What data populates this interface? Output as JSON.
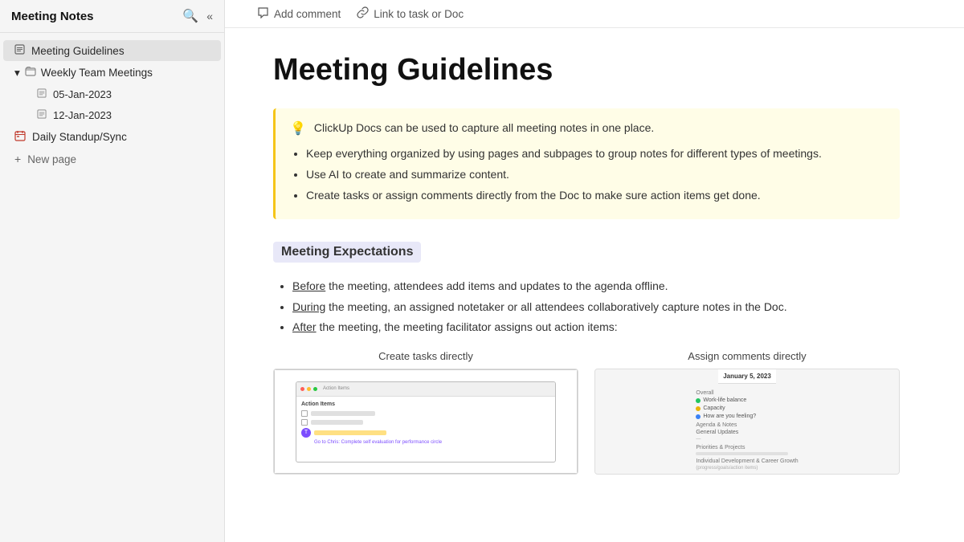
{
  "sidebar": {
    "title": "Meeting Notes",
    "items": [
      {
        "id": "meeting-guidelines",
        "label": "Meeting Guidelines",
        "type": "doc",
        "active": true
      },
      {
        "id": "weekly-team-meetings",
        "label": "Weekly Team Meetings",
        "type": "folder",
        "expanded": true,
        "children": [
          {
            "id": "jan-05",
            "label": "05-Jan-2023",
            "type": "doc"
          },
          {
            "id": "jan-12",
            "label": "12-Jan-2023",
            "type": "doc"
          }
        ]
      },
      {
        "id": "daily-standup",
        "label": "Daily Standup/Sync",
        "type": "calendar"
      },
      {
        "id": "new-page",
        "label": "New page",
        "type": "new"
      }
    ]
  },
  "toolbar": {
    "add_comment_label": "Add comment",
    "link_task_label": "Link to task or Doc"
  },
  "content": {
    "page_title": "Meeting Guidelines",
    "callout": {
      "emoji": "💡",
      "text": "ClickUp Docs can be used to capture all meeting notes in one place.",
      "bullets": [
        "Keep everything organized by using pages and subpages to group notes for different types of meetings.",
        "Use AI to create and summarize content.",
        "Create tasks or assign comments directly from the Doc to make sure action items get done."
      ]
    },
    "section_heading": "Meeting Expectations",
    "bullets": [
      {
        "prefix_underline": "Before",
        "rest": " the meeting, attendees add items and updates to the agenda offline."
      },
      {
        "prefix_underline": "During",
        "rest": " the meeting, an assigned notetaker or all attendees collaboratively capture notes in the Doc."
      },
      {
        "prefix_underline": "After",
        "rest": " the meeting, the meeting facilitator assigns out action items:"
      }
    ],
    "images": {
      "left_caption": "Create tasks directly",
      "right_caption": "Assign comments directly",
      "right_date": "January 5, 2023"
    }
  },
  "icons": {
    "search": "🔍",
    "collapse": "«",
    "doc": "📄",
    "folder": "📅",
    "calendar": "📅",
    "chevron_down": "▾",
    "chevron_right": "▸",
    "plus": "+",
    "comment": "💬",
    "link": "🔗"
  }
}
